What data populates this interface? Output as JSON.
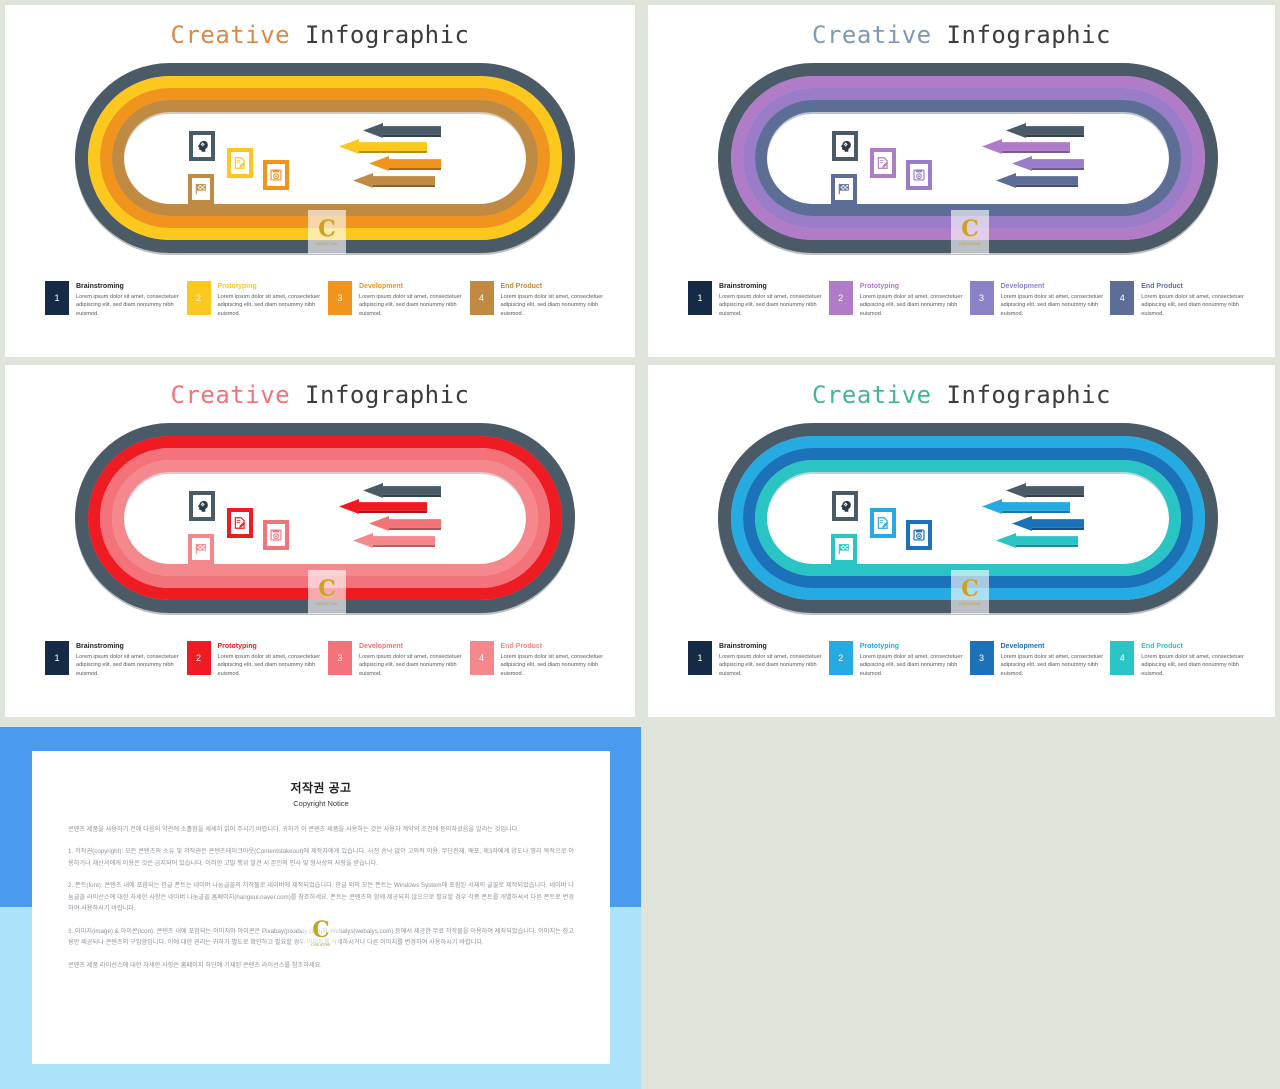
{
  "page": {
    "background_color": "#dfe4da"
  },
  "slides": [
    {
      "id": "orange",
      "title_accent": "Creative",
      "title_rest": " Infographic",
      "title_accent_color": "#d9894a",
      "title_rest_color": "#3c3c3c",
      "ring_colors": [
        "#4a5a66",
        "#fcc81e",
        "#f0941e",
        "#c08a42"
      ],
      "arrow_colors": [
        "#4a5a66",
        "#fcc81e",
        "#f0941e",
        "#c08a42"
      ],
      "icon_box_colors": [
        "#4a5a66",
        "#fcc81e",
        "#f0941e",
        "#c08a42"
      ],
      "legend": [
        {
          "num": "1",
          "label": "Brainstroming",
          "color": "#152a44",
          "label_color": "#222222",
          "body": "Lorem ipsum dolor sit amet, consectetuer adipiscing elit, sed diam nonummy nibh euismod."
        },
        {
          "num": "2",
          "label": "Prototyping",
          "color": "#fcc81e",
          "label_color": "#fcc81e",
          "body": "Lorem ipsum dolor sit amet, consectetuer adipiscing elit, sed diam nonummy nibh euismod."
        },
        {
          "num": "3",
          "label": "Development",
          "color": "#f0941e",
          "label_color": "#f0941e",
          "body": "Lorem ipsum dolor sit amet, consectetuer adipiscing elit, sed diam nonummy nibh euismod."
        },
        {
          "num": "4",
          "label": "End Product",
          "color": "#c08a42",
          "label_color": "#c08a42",
          "body": "Lorem ipsum dolor sit amet, consectetuer adipiscing elit, sed diam nonummy nibh euismod."
        }
      ]
    },
    {
      "id": "purple",
      "title_accent": "Creative",
      "title_rest": " Infographic",
      "title_accent_color": "#7f98b5",
      "title_rest_color": "#3c3c3c",
      "ring_colors": [
        "#4a5a66",
        "#b07cc8",
        "#9a7cc8",
        "#5d6e96"
      ],
      "arrow_colors": [
        "#4a5a66",
        "#b07cc8",
        "#9a7cc8",
        "#5d6e96"
      ],
      "icon_box_colors": [
        "#4a5a66",
        "#b07cc8",
        "#9a7cc8",
        "#5d6e96"
      ],
      "legend": [
        {
          "num": "1",
          "label": "Brainstroming",
          "color": "#152a44",
          "label_color": "#222222",
          "body": "Lorem ipsum dolor sit amet, consectetuer adipiscing elit, sed diam nonummy nibh euismod."
        },
        {
          "num": "2",
          "label": "Prototyping",
          "color": "#b07cc8",
          "label_color": "#b07cc8",
          "body": "Lorem ipsum dolor sit amet, consectetuer adipiscing elit, sed diam nonummy nibh euismod."
        },
        {
          "num": "3",
          "label": "Development",
          "color": "#8a82c8",
          "label_color": "#8a82c8",
          "body": "Lorem ipsum dolor sit amet, consectetuer adipiscing elit, sed diam nonummy nibh euismod."
        },
        {
          "num": "4",
          "label": "End Product",
          "color": "#5d6e96",
          "label_color": "#5d6e96",
          "body": "Lorem ipsum dolor sit amet, consectetuer adipiscing elit, sed diam nonummy nibh euismod."
        }
      ]
    },
    {
      "id": "red",
      "title_accent": "Creative",
      "title_rest": " Infographic",
      "title_accent_color": "#f4737a",
      "title_rest_color": "#3c3c3c",
      "ring_colors": [
        "#4a5a66",
        "#ee1c22",
        "#f4737a",
        "#f4888c"
      ],
      "arrow_colors": [
        "#4a5a66",
        "#ee1c22",
        "#f4737a",
        "#f4888c"
      ],
      "icon_box_colors": [
        "#4a5a66",
        "#ee1c22",
        "#f4737a",
        "#f4888c"
      ],
      "legend": [
        {
          "num": "1",
          "label": "Brainstroming",
          "color": "#152a44",
          "label_color": "#222222",
          "body": "Lorem ipsum dolor sit amet, consectetuer adipiscing elit, sed diam nonummy nibh euismod."
        },
        {
          "num": "2",
          "label": "Prototyping",
          "color": "#ee1c22",
          "label_color": "#ee1c22",
          "body": "Lorem ipsum dolor sit amet, consectetuer adipiscing elit, sed diam nonummy nibh euismod."
        },
        {
          "num": "3",
          "label": "Development",
          "color": "#f4737a",
          "label_color": "#f4737a",
          "body": "Lorem ipsum dolor sit amet, consectetuer adipiscing elit, sed diam nonummy nibh euismod."
        },
        {
          "num": "4",
          "label": "End Product",
          "color": "#f4888c",
          "label_color": "#f4888c",
          "body": "Lorem ipsum dolor sit amet, consectetuer adipiscing elit, sed diam nonummy nibh euismod."
        }
      ]
    },
    {
      "id": "blue",
      "title_accent": "Creative",
      "title_rest": " Infographic",
      "title_accent_color": "#42b59a",
      "title_rest_color": "#3c3c3c",
      "ring_colors": [
        "#4a5a66",
        "#25aae1",
        "#1c72b8",
        "#2bc4c4"
      ],
      "arrow_colors": [
        "#4a5a66",
        "#25aae1",
        "#1c72b8",
        "#2bc4c4"
      ],
      "icon_box_colors": [
        "#4a5a66",
        "#25aae1",
        "#1c72b8",
        "#2bc4c4"
      ],
      "legend": [
        {
          "num": "1",
          "label": "Brainstroming",
          "color": "#152a44",
          "label_color": "#222222",
          "body": "Lorem ipsum dolor sit amet, consectetuer adipiscing elit, sed diam nonummy nibh euismod."
        },
        {
          "num": "2",
          "label": "Prototyping",
          "color": "#25aae1",
          "label_color": "#25aae1",
          "body": "Lorem ipsum dolor sit amet, consectetuer adipiscing elit, sed diam nonummy nibh euismod."
        },
        {
          "num": "3",
          "label": "Development",
          "color": "#1c72b8",
          "label_color": "#1c72b8",
          "body": "Lorem ipsum dolor sit amet, consectetuer adipiscing elit, sed diam nonummy nibh euismod."
        },
        {
          "num": "4",
          "label": "End Product",
          "color": "#2bc4c4",
          "label_color": "#2bc4c4",
          "body": "Lorem ipsum dolor sit amet, consectetuer adipiscing elit, sed diam nonummy nibh euismod."
        }
      ]
    }
  ],
  "icons": {
    "brainstorming": "head-gear-icon",
    "prototyping": "pencil-document-icon",
    "development": "image-file-icon",
    "end_product": "checkered-flag-icon"
  },
  "watermark": {
    "letter": "C",
    "sub": "CREATIVE"
  },
  "copyright": {
    "title_ko": "저작권 공고",
    "title_en": "Copyright Notice",
    "frame_color": "#4a9bf0",
    "frame_lower_color": "#ade2fb",
    "paragraphs": [
      "콘텐츠 제품을 사용하기 전에 다음의 약관에 소홀함을 세세히 읽어 주시기 바랍니다. 귀하가 이 콘텐츠 제품을 사용하는 것은 사용자 계약의 조건에 동의하셨음을 알리는 것입니다.",
      "1. 저작권(copyright): 모든 콘텐츠의 소유 및 저작권은 콘텐츠테이크아웃(Contentstakeout)에 제작자에게 있습니다. 사전 승낙 없이 고의적 이용, 무단전재, 배포, 제3자에게 양도나 영리 목적으로 이용하거나 재산서에게 이용은 것은 금지되어 있습니다. 이러한 고발 행위 발견 시 본인의 민사 및 형사상의 사항을 받습니다.",
      "2. 폰트(font): 콘텐츠 내에 포함되는 한글 폰트는 네이버 나눔글꼴의 저작물로 네이버에 제작되었습니다. 한글 외의 모든 폰트는 Windows System에 포함된 서체의 글꼴로 제작되었습니다. 네이버 나눔글꼴 라이선스에 대한 자세한 사항은 네이버 나눔글꼴 홈페이지(hangeul.naver.com)를 참조하세요. 폰트는 콘텐츠의 함께 제공되지 않으므로 필요할 경우 각종 폰트를 개별하셔서 다른 폰트로 변경하여 사용하시기 바랍니다.",
      "3. 이미지(image) & 아이콘(icon): 콘텐츠 내에 포함되는 이미지와 아이콘은 Pixabay(pixabay.com)와 Webalys(webalys.com) 등에서 제공한 무료 저작물을 이용하여 제작되었습니다. 이미지는 참고용만 제공되나 콘텐츠의 구입함입니다. 이에 대한 권리는 귀하가 별도로 확인하고 필요할 경우 이미지를 삭제하시거나 다른 이미지를 변경하여 사용하시기 바랍니다.",
      "콘텐츠 제품 라이선스에 대한 자세한 사항은 홈페이지 하단에 기재된 콘텐츠 라이선스를 참조하세요."
    ]
  }
}
